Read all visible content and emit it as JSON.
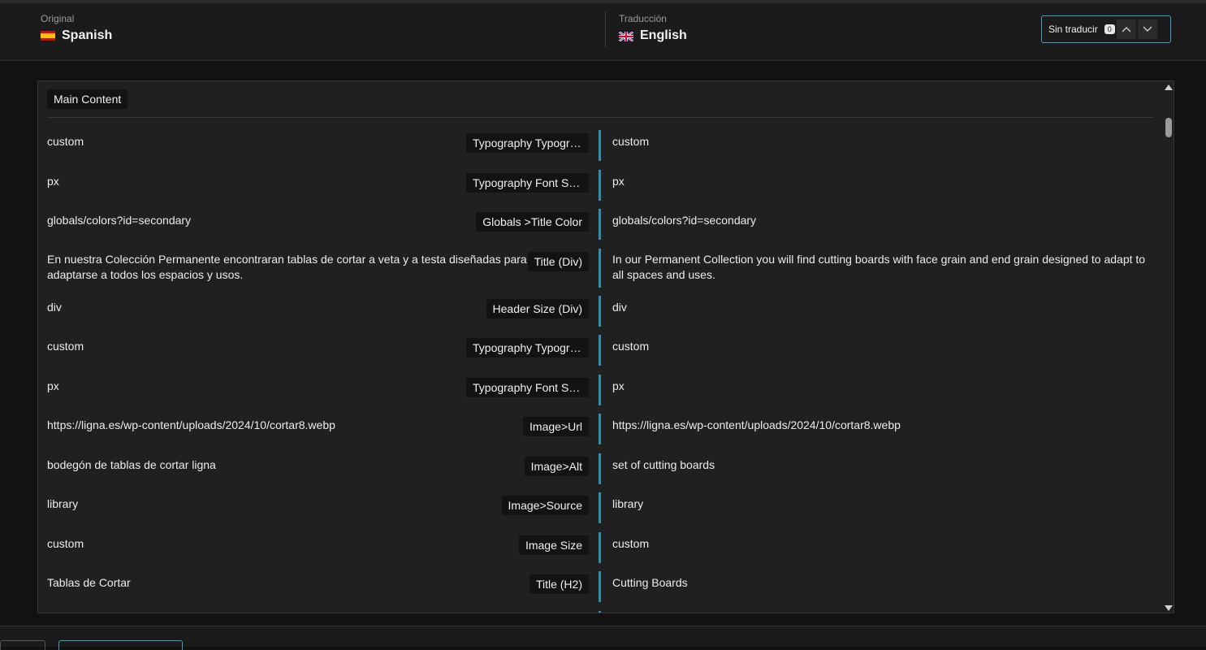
{
  "header": {
    "original": {
      "caption": "Original",
      "language": "Spanish",
      "flag_icon": "spain-flag-icon"
    },
    "translation": {
      "caption": "Traducción",
      "language": "English",
      "flag_icon": "uk-flag-icon"
    },
    "untranslated": {
      "label": "Sin traducir",
      "count": "0"
    }
  },
  "section": {
    "label": "Main Content"
  },
  "rows": [
    {
      "source": "custom",
      "tag": "Typography Typography",
      "target": "custom"
    },
    {
      "source": "px",
      "tag": "Typography Font Size",
      "target": "px"
    },
    {
      "source": "globals/colors?id=secondary",
      "tag": "Globals >Title Color",
      "target": "globals/colors?id=secondary"
    },
    {
      "source": "En nuestra Colección Permanente encontraran tablas de cortar a veta y a testa diseñadas para adaptarse a todos los espacios y usos.",
      "tag": "Title (Div)",
      "target": "In our Permanent Collection you will find cutting boards with face grain and end grain designed to adapt to all spaces and uses."
    },
    {
      "source": "div",
      "tag": "Header Size (Div)",
      "target": "div"
    },
    {
      "source": "custom",
      "tag": "Typography Typography",
      "target": "custom"
    },
    {
      "source": "px",
      "tag": "Typography Font Size",
      "target": "px"
    },
    {
      "source": "https://ligna.es/wp-content/uploads/2024/10/cortar8.webp",
      "tag": "Image>Url",
      "target": "https://ligna.es/wp-content/uploads/2024/10/cortar8.webp"
    },
    {
      "source": "bodegón de tablas de cortar ligna",
      "tag": "Image>Alt",
      "target": "set of cutting boards"
    },
    {
      "source": "library",
      "tag": "Image>Source",
      "target": "library"
    },
    {
      "source": "custom",
      "tag": "Image Size",
      "target": "custom"
    },
    {
      "source": "Tablas de Cortar",
      "tag": "Title (H2)",
      "target": "Cutting Boards"
    }
  ],
  "colors": {
    "accent": "#2f8fae",
    "background": "#121212",
    "panel": "#202020"
  }
}
